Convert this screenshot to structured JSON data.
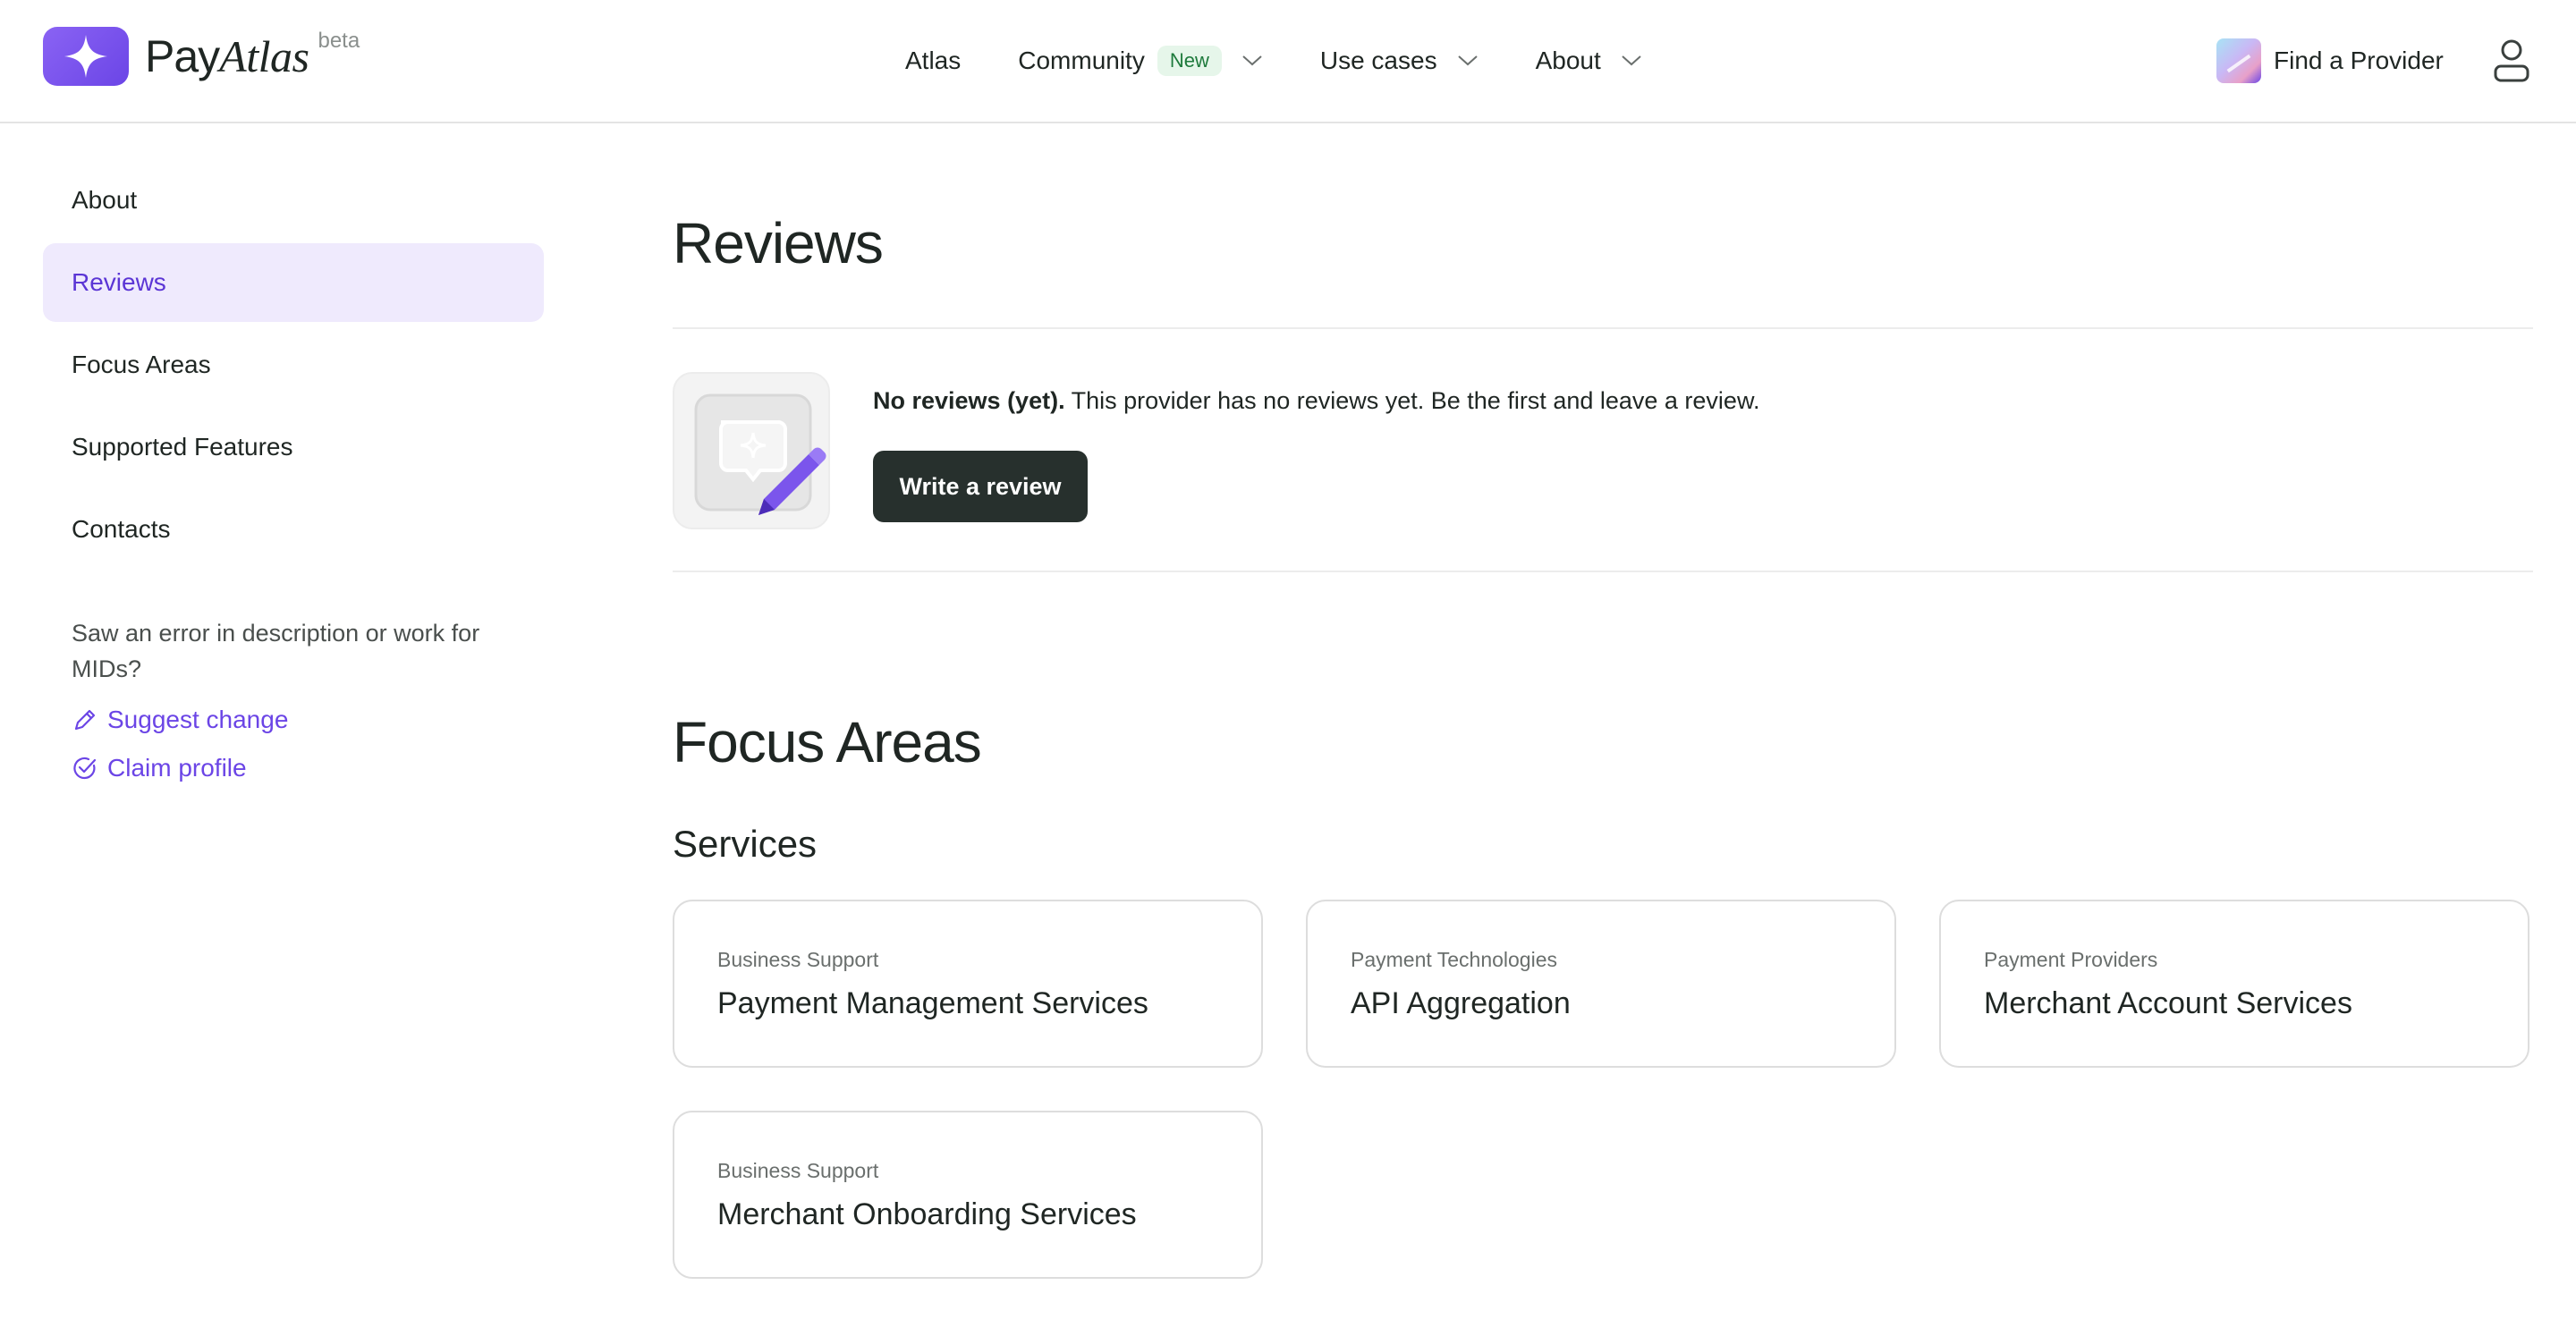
{
  "header": {
    "logo_pay": "Pay",
    "logo_atlas": "Atlas",
    "logo_beta": "beta",
    "nav": [
      {
        "label": "Atlas"
      },
      {
        "label": "Community",
        "badge": "New"
      },
      {
        "label": "Use cases"
      },
      {
        "label": "About"
      }
    ],
    "find_provider": "Find a Provider"
  },
  "sidebar": {
    "items": [
      {
        "label": "About"
      },
      {
        "label": "Reviews"
      },
      {
        "label": "Focus Areas"
      },
      {
        "label": "Supported Features"
      },
      {
        "label": "Contacts"
      }
    ],
    "active_index": 1,
    "note": "Saw an error in description or work for MIDs?",
    "suggest_change": "Suggest change",
    "claim_profile": "Claim profile"
  },
  "reviews": {
    "title": "Reviews",
    "message_bold": "No reviews (yet).",
    "message_rest": " This provider has no reviews yet. Be the first and leave a review.",
    "write_button": "Write a review"
  },
  "focus_areas": {
    "title": "Focus Areas",
    "services_title": "Services",
    "cards": [
      {
        "category": "Business Support",
        "title": "Payment Management Services"
      },
      {
        "category": "Payment Technologies",
        "title": "API Aggregation"
      },
      {
        "category": "Payment Providers",
        "title": "Merchant Account Services"
      },
      {
        "category": "Business Support",
        "title": "Merchant Onboarding Services"
      }
    ]
  },
  "colors": {
    "brand": "#6b45e6",
    "active_bg": "#efeafd",
    "button_dark": "#27302d",
    "badge_bg": "#e6f6ea",
    "badge_text": "#1e7a3c"
  }
}
